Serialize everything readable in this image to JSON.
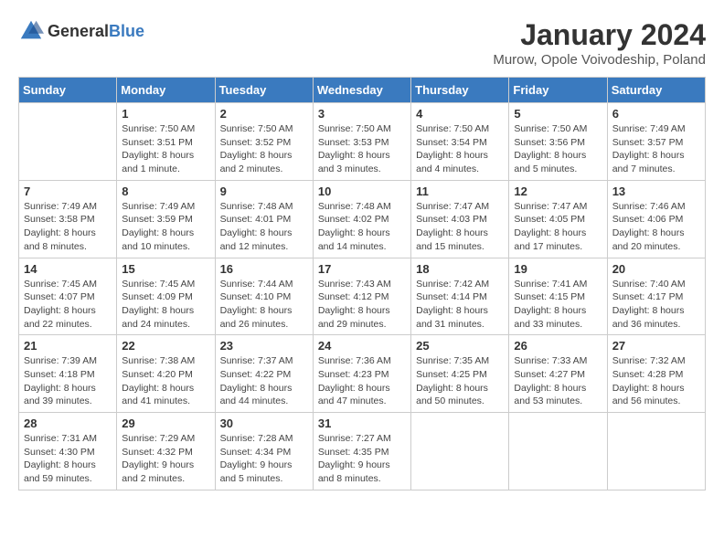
{
  "header": {
    "logo_general": "General",
    "logo_blue": "Blue",
    "title": "January 2024",
    "subtitle": "Murow, Opole Voivodeship, Poland"
  },
  "columns": [
    "Sunday",
    "Monday",
    "Tuesday",
    "Wednesday",
    "Thursday",
    "Friday",
    "Saturday"
  ],
  "weeks": [
    [
      {
        "day": "",
        "info": ""
      },
      {
        "day": "1",
        "info": "Sunrise: 7:50 AM\nSunset: 3:51 PM\nDaylight: 8 hours\nand 1 minute."
      },
      {
        "day": "2",
        "info": "Sunrise: 7:50 AM\nSunset: 3:52 PM\nDaylight: 8 hours\nand 2 minutes."
      },
      {
        "day": "3",
        "info": "Sunrise: 7:50 AM\nSunset: 3:53 PM\nDaylight: 8 hours\nand 3 minutes."
      },
      {
        "day": "4",
        "info": "Sunrise: 7:50 AM\nSunset: 3:54 PM\nDaylight: 8 hours\nand 4 minutes."
      },
      {
        "day": "5",
        "info": "Sunrise: 7:50 AM\nSunset: 3:56 PM\nDaylight: 8 hours\nand 5 minutes."
      },
      {
        "day": "6",
        "info": "Sunrise: 7:49 AM\nSunset: 3:57 PM\nDaylight: 8 hours\nand 7 minutes."
      }
    ],
    [
      {
        "day": "7",
        "info": "Sunrise: 7:49 AM\nSunset: 3:58 PM\nDaylight: 8 hours\nand 8 minutes."
      },
      {
        "day": "8",
        "info": "Sunrise: 7:49 AM\nSunset: 3:59 PM\nDaylight: 8 hours\nand 10 minutes."
      },
      {
        "day": "9",
        "info": "Sunrise: 7:48 AM\nSunset: 4:01 PM\nDaylight: 8 hours\nand 12 minutes."
      },
      {
        "day": "10",
        "info": "Sunrise: 7:48 AM\nSunset: 4:02 PM\nDaylight: 8 hours\nand 14 minutes."
      },
      {
        "day": "11",
        "info": "Sunrise: 7:47 AM\nSunset: 4:03 PM\nDaylight: 8 hours\nand 15 minutes."
      },
      {
        "day": "12",
        "info": "Sunrise: 7:47 AM\nSunset: 4:05 PM\nDaylight: 8 hours\nand 17 minutes."
      },
      {
        "day": "13",
        "info": "Sunrise: 7:46 AM\nSunset: 4:06 PM\nDaylight: 8 hours\nand 20 minutes."
      }
    ],
    [
      {
        "day": "14",
        "info": "Sunrise: 7:45 AM\nSunset: 4:07 PM\nDaylight: 8 hours\nand 22 minutes."
      },
      {
        "day": "15",
        "info": "Sunrise: 7:45 AM\nSunset: 4:09 PM\nDaylight: 8 hours\nand 24 minutes."
      },
      {
        "day": "16",
        "info": "Sunrise: 7:44 AM\nSunset: 4:10 PM\nDaylight: 8 hours\nand 26 minutes."
      },
      {
        "day": "17",
        "info": "Sunrise: 7:43 AM\nSunset: 4:12 PM\nDaylight: 8 hours\nand 29 minutes."
      },
      {
        "day": "18",
        "info": "Sunrise: 7:42 AM\nSunset: 4:14 PM\nDaylight: 8 hours\nand 31 minutes."
      },
      {
        "day": "19",
        "info": "Sunrise: 7:41 AM\nSunset: 4:15 PM\nDaylight: 8 hours\nand 33 minutes."
      },
      {
        "day": "20",
        "info": "Sunrise: 7:40 AM\nSunset: 4:17 PM\nDaylight: 8 hours\nand 36 minutes."
      }
    ],
    [
      {
        "day": "21",
        "info": "Sunrise: 7:39 AM\nSunset: 4:18 PM\nDaylight: 8 hours\nand 39 minutes."
      },
      {
        "day": "22",
        "info": "Sunrise: 7:38 AM\nSunset: 4:20 PM\nDaylight: 8 hours\nand 41 minutes."
      },
      {
        "day": "23",
        "info": "Sunrise: 7:37 AM\nSunset: 4:22 PM\nDaylight: 8 hours\nand 44 minutes."
      },
      {
        "day": "24",
        "info": "Sunrise: 7:36 AM\nSunset: 4:23 PM\nDaylight: 8 hours\nand 47 minutes."
      },
      {
        "day": "25",
        "info": "Sunrise: 7:35 AM\nSunset: 4:25 PM\nDaylight: 8 hours\nand 50 minutes."
      },
      {
        "day": "26",
        "info": "Sunrise: 7:33 AM\nSunset: 4:27 PM\nDaylight: 8 hours\nand 53 minutes."
      },
      {
        "day": "27",
        "info": "Sunrise: 7:32 AM\nSunset: 4:28 PM\nDaylight: 8 hours\nand 56 minutes."
      }
    ],
    [
      {
        "day": "28",
        "info": "Sunrise: 7:31 AM\nSunset: 4:30 PM\nDaylight: 8 hours\nand 59 minutes."
      },
      {
        "day": "29",
        "info": "Sunrise: 7:29 AM\nSunset: 4:32 PM\nDaylight: 9 hours\nand 2 minutes."
      },
      {
        "day": "30",
        "info": "Sunrise: 7:28 AM\nSunset: 4:34 PM\nDaylight: 9 hours\nand 5 minutes."
      },
      {
        "day": "31",
        "info": "Sunrise: 7:27 AM\nSunset: 4:35 PM\nDaylight: 9 hours\nand 8 minutes."
      },
      {
        "day": "",
        "info": ""
      },
      {
        "day": "",
        "info": ""
      },
      {
        "day": "",
        "info": ""
      }
    ]
  ]
}
